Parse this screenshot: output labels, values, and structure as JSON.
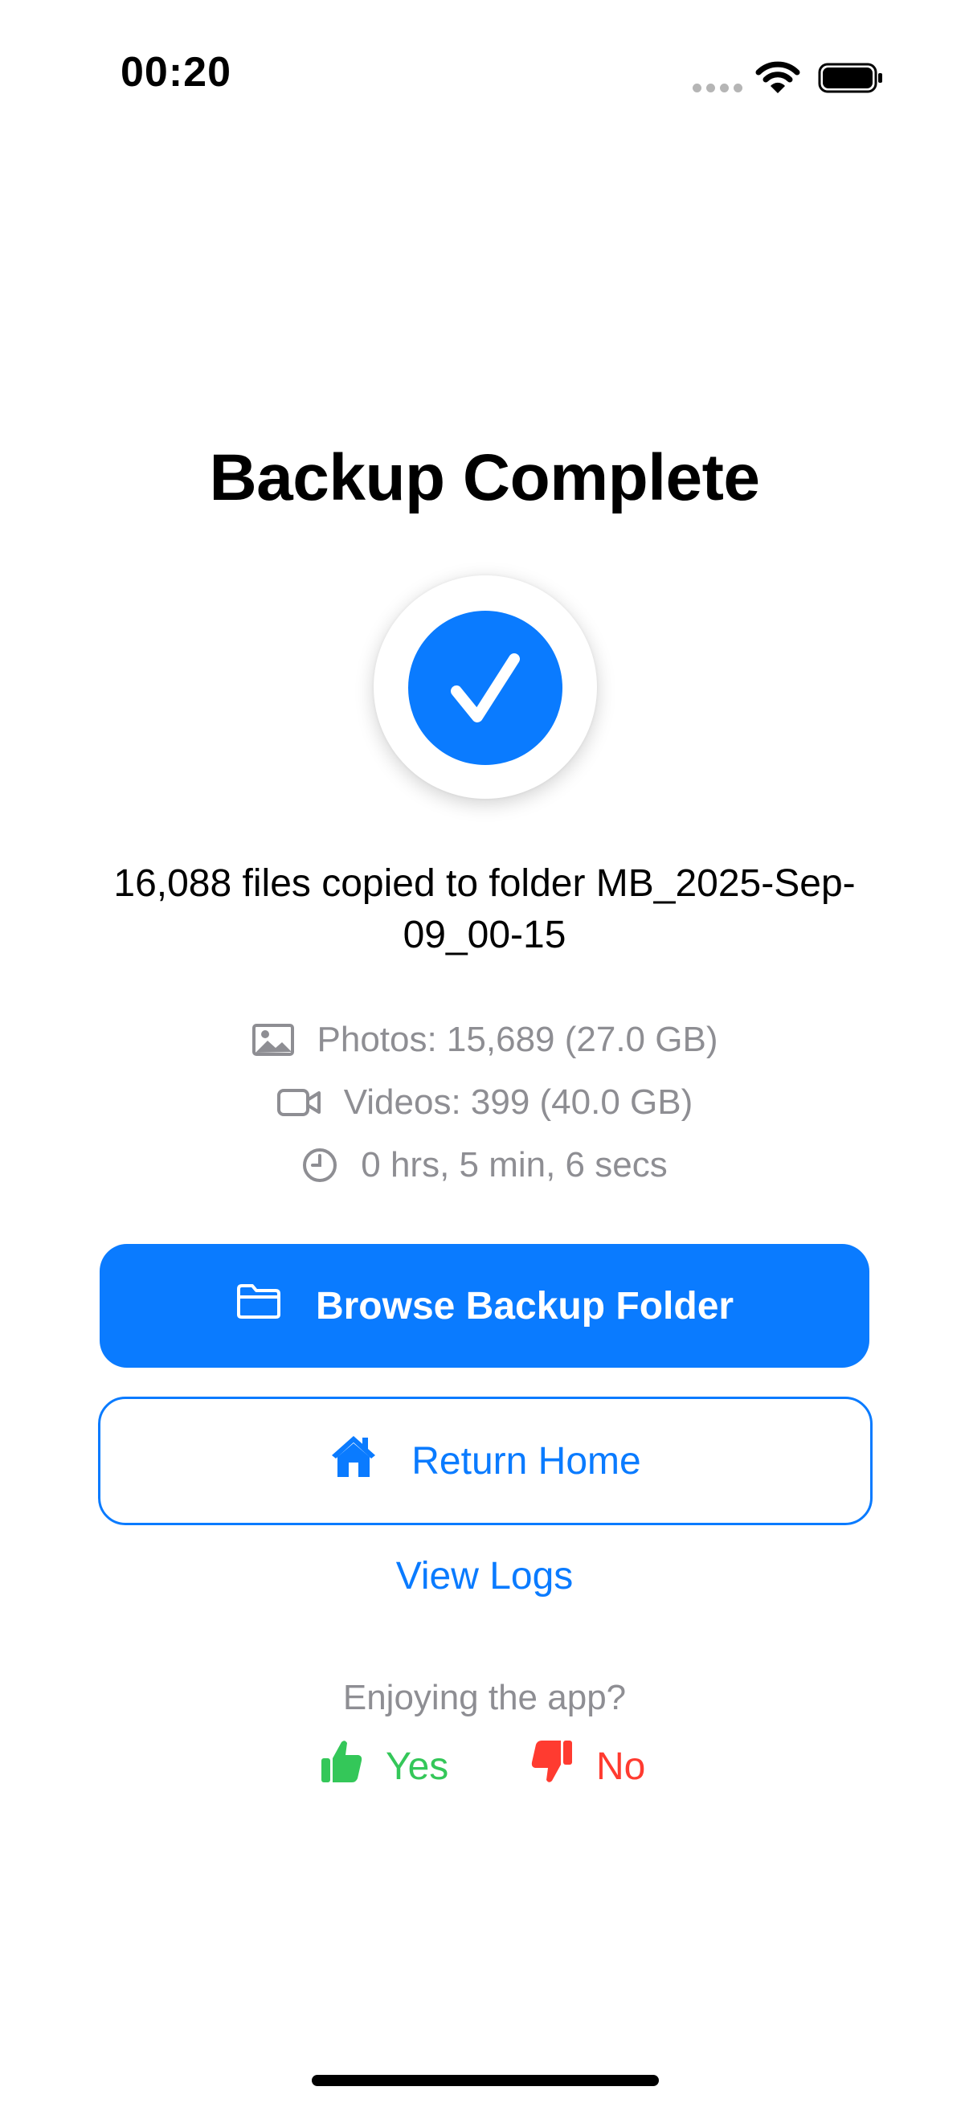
{
  "status_bar": {
    "time": "00:20"
  },
  "screen": {
    "title": "Backup Complete",
    "summary": "16,088 files copied to folder MB_2025-Sep-09_00-15",
    "stats": {
      "photos": "Photos: 15,689 (27.0 GB)",
      "videos": "Videos: 399 (40.0 GB)",
      "duration": "0 hrs, 5 min, 6 secs"
    }
  },
  "actions": {
    "browse_label": "Browse Backup Folder",
    "home_label": "Return Home",
    "logs_label": "View Logs"
  },
  "feedback": {
    "prompt": "Enjoying the app?",
    "yes_label": "Yes",
    "no_label": "No"
  },
  "colors": {
    "accent": "#0a7bff",
    "secondary_text": "#8e8e93",
    "positive": "#34c759",
    "negative": "#ff3b30"
  },
  "icons": {
    "signal": "cellular-signal-icon",
    "wifi": "wifi-icon",
    "battery": "battery-icon",
    "check": "checkmark-icon",
    "photo": "photo-icon",
    "video": "video-camera-icon",
    "clock": "clock-icon",
    "folder": "folder-icon",
    "home": "house-icon",
    "thumbs_up": "thumbs-up-icon",
    "thumbs_down": "thumbs-down-icon"
  }
}
